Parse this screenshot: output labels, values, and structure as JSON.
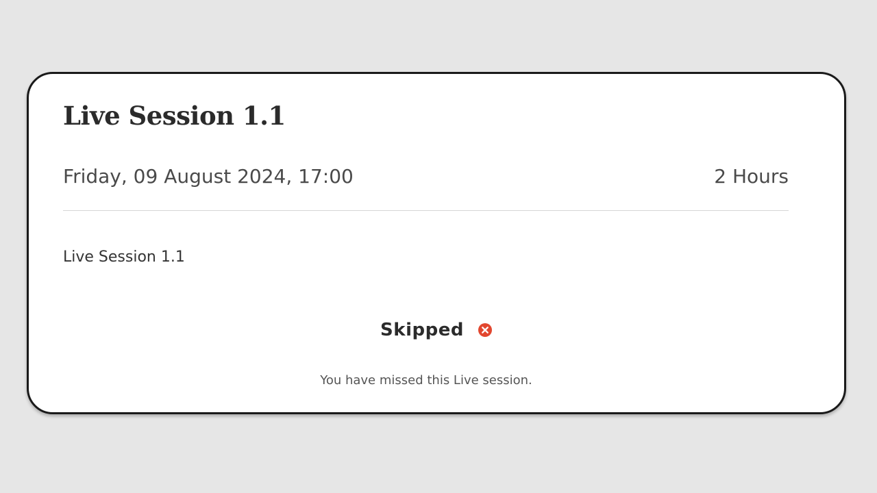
{
  "session": {
    "title": "Live Session 1.1",
    "datetime": "Friday, 09 August 2024, 17:00",
    "duration": "2 Hours",
    "description": "Live Session 1.1"
  },
  "status": {
    "label": "Skipped",
    "icon": "x-circle-icon",
    "icon_color": "#e2472f",
    "message": "You have missed this Live session."
  }
}
